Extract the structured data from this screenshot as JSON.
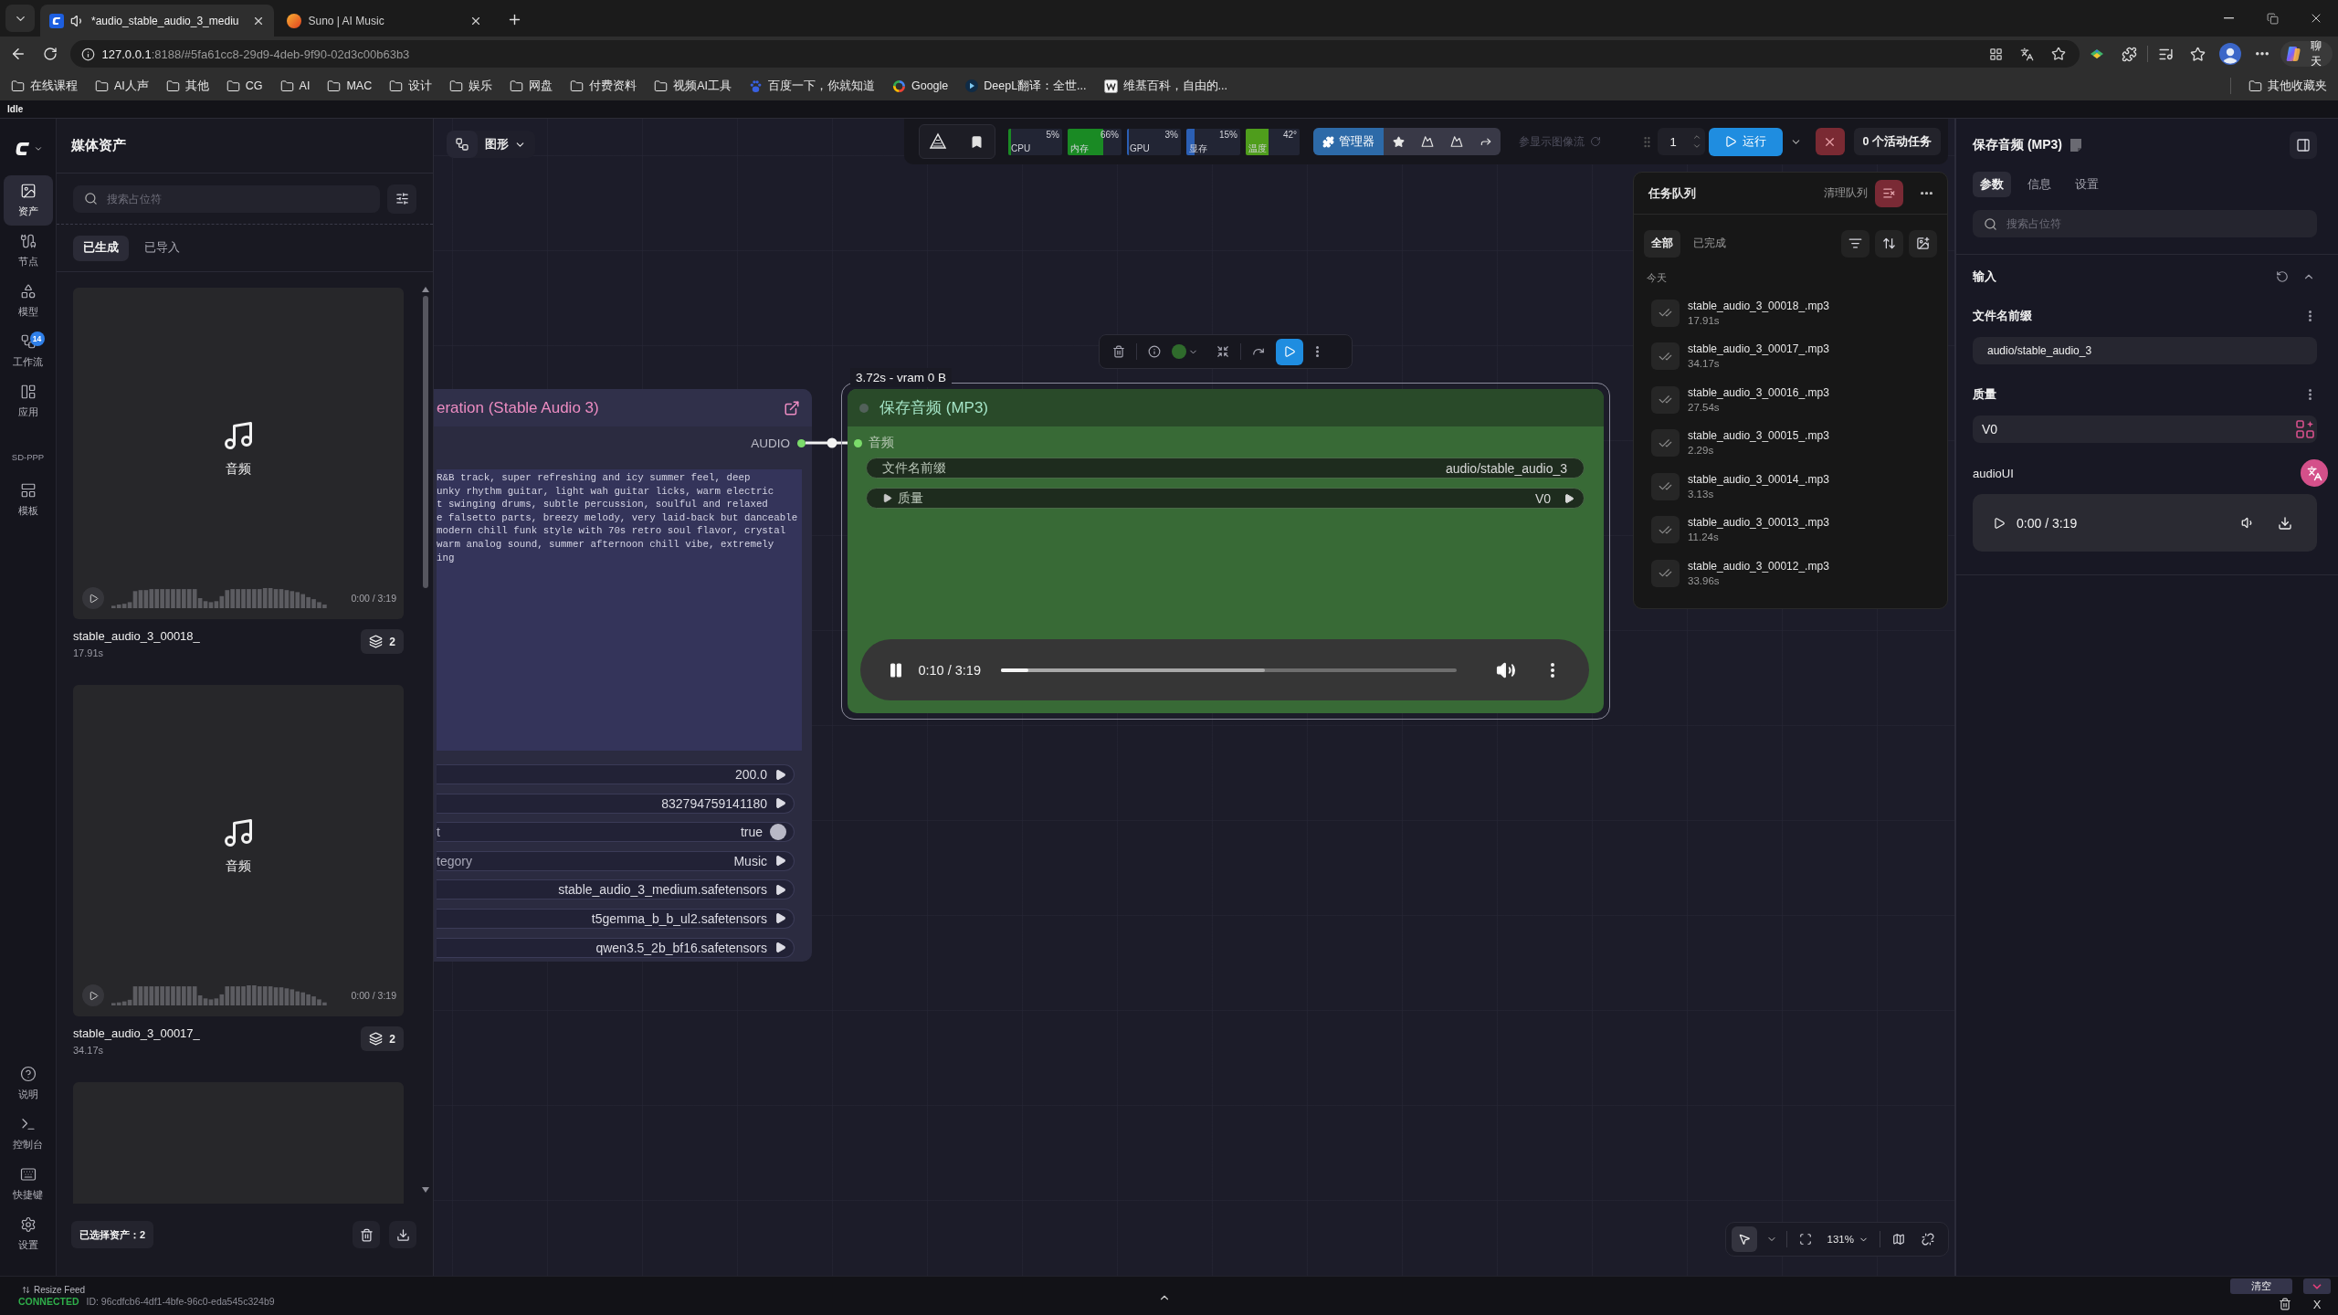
{
  "browser": {
    "tabs": [
      {
        "title": "*audio_stable_audio_3_mediu",
        "selected": true,
        "audio": true
      },
      {
        "title": "Suno | AI Music",
        "selected": false,
        "audio": false
      }
    ],
    "url": {
      "host": "127.0.0.1",
      "rest": ":8188/#5fa61cc8-29d9-4deb-9f90-02d3c00b63b3"
    },
    "bookmarks": [
      {
        "kind": "folder",
        "label": "在线课程"
      },
      {
        "kind": "folder",
        "label": "AI人声"
      },
      {
        "kind": "folder",
        "label": "其他"
      },
      {
        "kind": "folder",
        "label": "CG"
      },
      {
        "kind": "folder",
        "label": "AI"
      },
      {
        "kind": "folder",
        "label": "MAC"
      },
      {
        "kind": "folder",
        "label": "设计"
      },
      {
        "kind": "folder",
        "label": "娱乐"
      },
      {
        "kind": "folder",
        "label": "网盘"
      },
      {
        "kind": "folder",
        "label": "付费资料"
      },
      {
        "kind": "folder",
        "label": "视频AI工具"
      },
      {
        "kind": "site",
        "label": "百度一下，你就知道"
      },
      {
        "kind": "site",
        "label": "Google"
      },
      {
        "kind": "site",
        "label": "DeepL翻译：全世..."
      },
      {
        "kind": "site",
        "label": "维基百科，自由的..."
      }
    ],
    "other_bookmarks": "其他收藏夹",
    "chat": "聊天"
  },
  "app_status": "Idle",
  "rail": {
    "items": [
      {
        "label": "资产",
        "selected": true
      },
      {
        "label": "节点",
        "selected": false
      },
      {
        "label": "模型",
        "selected": false
      },
      {
        "label": "工作流",
        "selected": false,
        "badge": "14"
      },
      {
        "label": "应用",
        "selected": false
      }
    ],
    "extension": {
      "title": "SD-PPP",
      "items": [
        {
          "label": "模板",
          "selected": false
        }
      ]
    },
    "bottom_items": [
      {
        "label": "说明"
      },
      {
        "label": "控制台"
      },
      {
        "label": "快捷键"
      },
      {
        "label": "设置"
      }
    ]
  },
  "assets": {
    "title": "媒体资产",
    "search": {
      "placeholder": "搜索占位符"
    },
    "tabs": [
      {
        "label": "已生成",
        "selected": true
      },
      {
        "label": "已导入",
        "selected": false
      }
    ],
    "items": [
      {
        "kind": "audio",
        "label": "音频",
        "time": "0:00 / 3:19",
        "name": "stable_audio_3_00018_",
        "duration": "17.91s",
        "count": "2"
      },
      {
        "kind": "audio",
        "label": "音频",
        "time": "0:00 / 3:19",
        "name": "stable_audio_3_00017_",
        "duration": "34.17s",
        "count": "2"
      },
      {
        "kind": "blank"
      }
    ],
    "selection": "已选择资产：2"
  },
  "canvas": {
    "graph_menu": "图形",
    "monitors": [
      {
        "label": "CPU",
        "reading": "5%",
        "level": 0.05,
        "color": "#1a8a24"
      },
      {
        "label": "内存",
        "reading": "66%",
        "level": 0.66,
        "color": "#1a8a24"
      },
      {
        "label": "GPU",
        "reading": "3%",
        "level": 0.03,
        "color": "#2b5fb4"
      },
      {
        "label": "显存",
        "reading": "15%",
        "level": 0.15,
        "color": "#2b5fb4"
      },
      {
        "label": "温度",
        "reading": "42°",
        "level": 0.42,
        "color": "#4f9d1c"
      }
    ],
    "manager": "管理器",
    "feed_toggle": "参显示图像流",
    "run": {
      "count": "1",
      "label": "运行",
      "active_tasks": "0 个活动任务"
    },
    "queue": {
      "title": "任务队列",
      "clear": "清理队列",
      "filters": [
        {
          "label": "全部",
          "selected": true
        },
        {
          "label": "已完成",
          "selected": false
        }
      ],
      "group": "今天",
      "items": [
        {
          "name": "stable_audio_3_00018_.mp3",
          "duration": "17.91s"
        },
        {
          "name": "stable_audio_3_00017_.mp3",
          "duration": "34.17s"
        },
        {
          "name": "stable_audio_3_00016_.mp3",
          "duration": "27.54s"
        },
        {
          "name": "stable_audio_3_00015_.mp3",
          "duration": "2.29s"
        },
        {
          "name": "stable_audio_3_00014_.mp3",
          "duration": "3.13s"
        },
        {
          "name": "stable_audio_3_00013_.mp3",
          "duration": "11.24s"
        },
        {
          "name": "stable_audio_3_00012_.mp3",
          "duration": "33.96s"
        }
      ]
    },
    "generator_node": {
      "title": "eration (Stable Audio 3)",
      "output": "AUDIO",
      "prompt_lines": [
        "R&B track, super refreshing and icy summer feel, deep",
        "unky rhythm guitar, light wah guitar licks, warm electric",
        "t swinging drums, subtle percussion, soulful and relaxed",
        "e falsetto parts, breezy melody, very laid-back but danceable",
        "modern chill funk style with 70s retro soul flavor, crystal",
        "warm analog sound, summer afternoon chill vibe, extremely",
        "ing"
      ],
      "widgets": [
        {
          "kind": "number",
          "value": "200.0"
        },
        {
          "kind": "number",
          "value": "832794759141180"
        },
        {
          "kind": "toggle",
          "label": "t",
          "value": "true",
          "on": true
        },
        {
          "kind": "combo",
          "label": "tegory",
          "value": "Music"
        },
        {
          "kind": "combo",
          "value": "stable_audio_3_medium.safetensors"
        },
        {
          "kind": "combo",
          "value": "t5gemma_b_b_ul2.safetensors"
        },
        {
          "kind": "combo",
          "value": "qwen3.5_2b_bf16.safetensors"
        }
      ]
    },
    "save_node": {
      "badge": "3.72s - vram 0 B",
      "title": "保存音频 (MP3)",
      "selected": true,
      "input": "音频",
      "widgets": [
        {
          "kind": "text",
          "label": "文件名前缀",
          "value": "audio/stable_audio_3"
        },
        {
          "kind": "combo",
          "label": "质量",
          "value": "V0"
        }
      ],
      "player": {
        "time": "0:10 / 3:19",
        "playing": true,
        "progress": {
          "level": 0.06
        },
        "buffered": {
          "level": 0.58
        }
      }
    },
    "zoom": "131%"
  },
  "properties": {
    "title": "保存音频 (MP3)",
    "tabs": [
      {
        "label": "参数",
        "selected": true
      },
      {
        "label": "信息",
        "selected": false
      },
      {
        "label": "设置",
        "selected": false
      }
    ],
    "search": {
      "placeholder": "搜索占位符"
    },
    "section": {
      "title": "输入",
      "expanded": true
    },
    "fields": [
      {
        "kind": "text",
        "label": "文件名前缀",
        "value": "audio/stable_audio_3"
      },
      {
        "kind": "select",
        "label": "质量",
        "value": "V0"
      },
      {
        "kind": "audio",
        "label": "audioUI",
        "time": "0:00 / 3:19",
        "playing": false
      }
    ]
  },
  "status_bar": {
    "feed": "Resize Feed",
    "connection": "CONNECTED",
    "id": "ID: 96cdfcb6-4df1-4bfe-96c0-eda545c324b9",
    "clear": "清空",
    "close": "X"
  }
}
